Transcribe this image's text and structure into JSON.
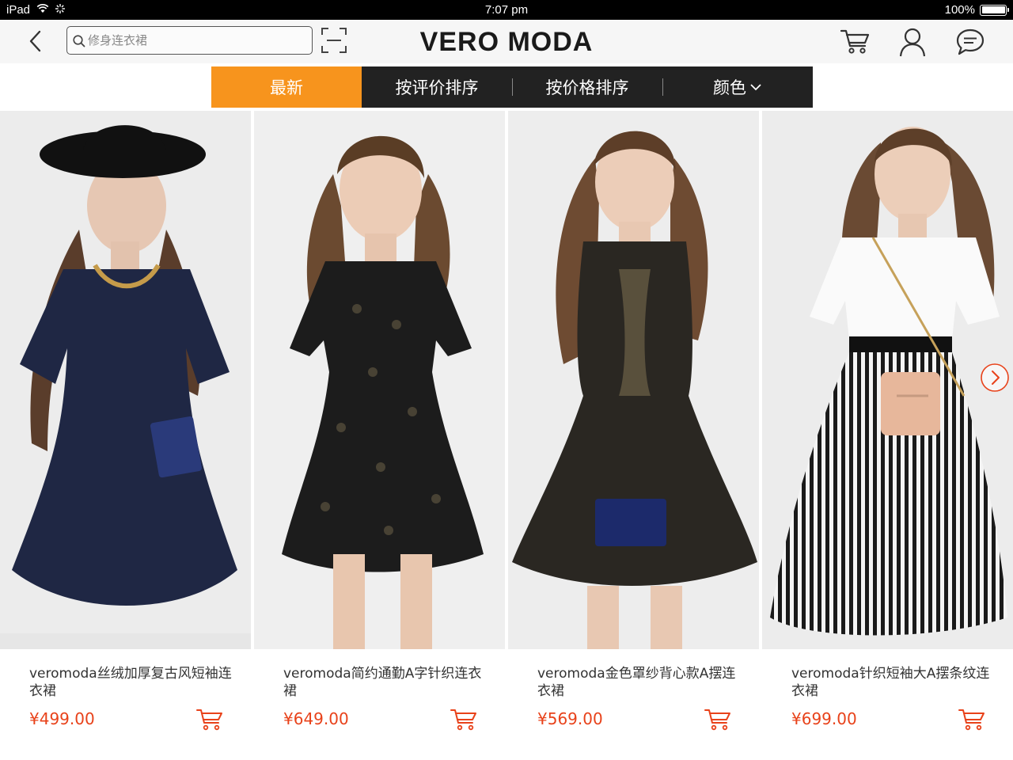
{
  "status_bar": {
    "device": "iPad",
    "time": "7:07 pm",
    "battery": "100%",
    "battery_level": 1.0
  },
  "header": {
    "brand": "VERO MODA",
    "search_placeholder": "修身连衣裙",
    "icons": [
      "back-icon",
      "search-icon",
      "scan-icon",
      "cart-icon",
      "user-icon",
      "chat-icon"
    ]
  },
  "filters": {
    "tabs": [
      {
        "label": "最新",
        "active": true
      },
      {
        "label": "按评价排序",
        "active": false
      },
      {
        "label": "按价格排序",
        "active": false
      },
      {
        "label": "颜色",
        "active": false
      }
    ]
  },
  "colors": {
    "accent": "#f7941d",
    "price": "#e8421a",
    "tab_bar": "#222222"
  },
  "products": [
    {
      "title": "veromoda丝绒加厚复古风短袖连衣裙",
      "price": "¥499.00",
      "dress_color": "#1f2744"
    },
    {
      "title": "veromoda简约通勤A字针织连衣裙",
      "price": "¥649.00",
      "dress_color": "#1c1c1c"
    },
    {
      "title": "veromoda金色罩纱背心款A摆连衣裙",
      "price": "¥569.00",
      "dress_color": "#2a2722"
    },
    {
      "title": "veromoda针织短袖大A摆条纹连衣裙",
      "price": "¥699.00",
      "dress_color": "#ececec"
    }
  ]
}
